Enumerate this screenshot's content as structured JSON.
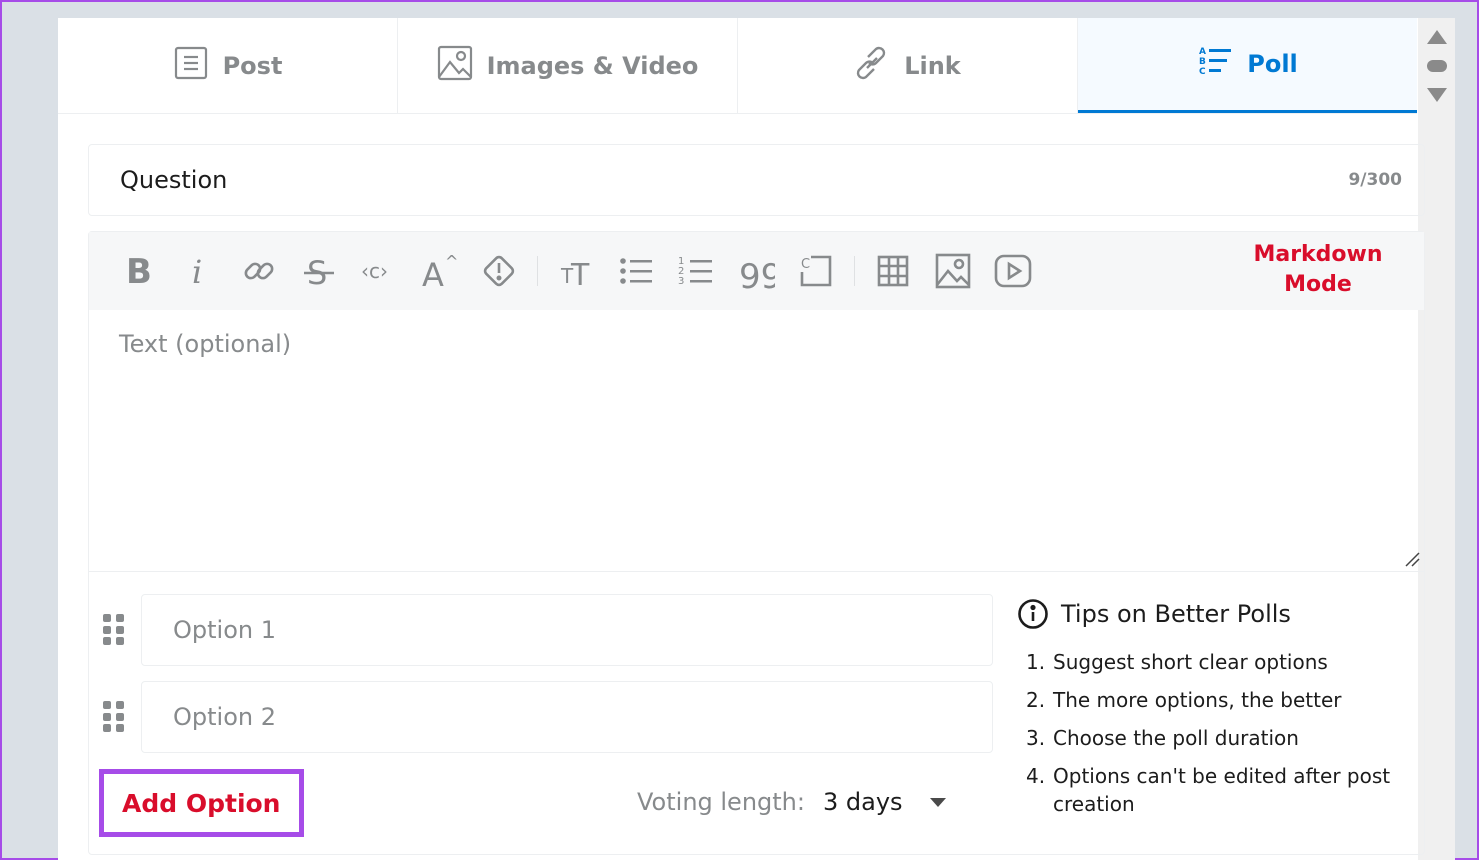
{
  "tabs": [
    {
      "label": "Post",
      "icon": "document-icon"
    },
    {
      "label": "Images & Video",
      "icon": "image-icon"
    },
    {
      "label": "Link",
      "icon": "link-icon"
    },
    {
      "label": "Poll",
      "icon": "poll-icon",
      "active": true
    }
  ],
  "question": {
    "value": "Question",
    "count": "9/300"
  },
  "toolbar": {
    "markdown_line1": "Markdown",
    "markdown_line2": "Mode"
  },
  "editor": {
    "placeholder": "Text (optional)"
  },
  "options": [
    {
      "placeholder": "Option 1"
    },
    {
      "placeholder": "Option 2"
    }
  ],
  "add_option_label": "Add Option",
  "voting": {
    "label": "Voting length:",
    "value": "3 days"
  },
  "tips": {
    "title": "Tips on Better Polls",
    "items": [
      {
        "n": "1.",
        "text": "Suggest short clear options"
      },
      {
        "n": "2.",
        "text": "The more options, the better"
      },
      {
        "n": "3.",
        "text": "Choose the poll duration"
      },
      {
        "n": "4.",
        "text": "Options can't be edited after post creation"
      }
    ]
  },
  "colors": {
    "accent": "#0079d3",
    "markdown": "#d90d2b",
    "highlight": "#a64ce8"
  }
}
